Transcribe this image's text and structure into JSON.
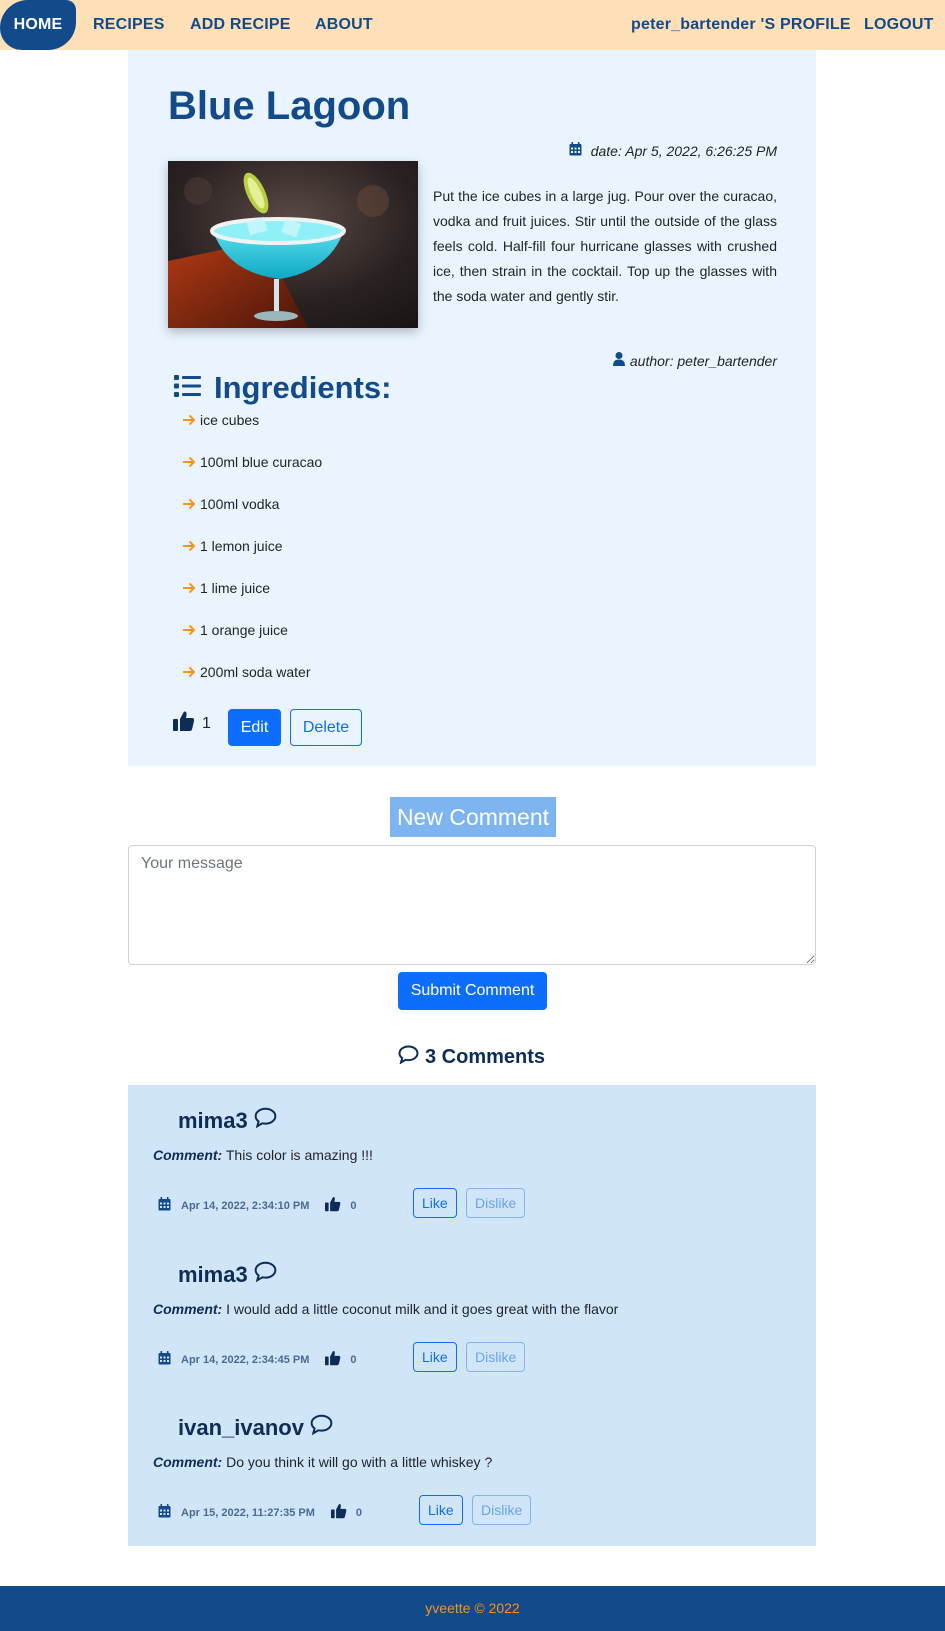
{
  "nav": {
    "home": "HOME",
    "recipes": "RECIPES",
    "add_recipe": "ADD RECIPE",
    "about": "ABOUT",
    "profile": "peter_bartender 'S PROFILE",
    "logout": "LOGOUT"
  },
  "recipe": {
    "title": "Blue Lagoon",
    "date": "date: Apr 5, 2022, 6:26:25 PM",
    "description": "Put the ice cubes in a large jug. Pour over the curacao, vodka and fruit juices. Stir until the outside of the glass feels cold. Half-fill four hurricane glasses with crushed ice, then strain in the cocktail. Top up the glasses with the soda water and gently stir.",
    "author": "author: peter_bartender",
    "ingredients_heading": "Ingredients:",
    "ingredients": [
      "ice cubes",
      "100ml blue curacao",
      "100ml vodka",
      "1 lemon juice",
      "1 lime juice",
      "1 orange juice",
      "200ml soda water"
    ],
    "likes": "1",
    "edit_label": "Edit",
    "delete_label": "Delete"
  },
  "new_comment": {
    "title": "New Comment",
    "placeholder": "Your message",
    "submit_label": "Submit Comment"
  },
  "comments": {
    "count_label": "3 Comments",
    "comment_label": "Comment:",
    "like_label": "Like",
    "dislike_label": "Dislike",
    "items": [
      {
        "author": "mima3",
        "text": "This color is amazing !!!",
        "date": "Apr 14, 2022, 2:34:10 PM",
        "likes": "0"
      },
      {
        "author": "mima3",
        "text": "I would add a little coconut milk and it goes great with the flavor",
        "date": "Apr 14, 2022, 2:34:45 PM",
        "likes": "0"
      },
      {
        "author": "ivan_ivanov",
        "text": "Do you think it will go with a little whiskey ?",
        "date": "Apr 15, 2022, 11:27:35 PM",
        "likes": "0"
      }
    ]
  },
  "footer": {
    "text": "yveette © 2022"
  },
  "colors": {
    "nav_bg": "#ffe0b8",
    "brand_blue": "#124a8a",
    "card_bg": "#e9f4fe",
    "comments_bg": "#d1e5f9",
    "primary": "#0d6efd",
    "accent_orange": "#f7941d"
  },
  "icons": {
    "date": "calendar-icon",
    "author": "user-icon",
    "ingredients": "list-icon",
    "ingredient_bullet": "arrow-right-icon",
    "likes": "thumbs-up-icon",
    "comments": "comment-bubble-icon"
  }
}
